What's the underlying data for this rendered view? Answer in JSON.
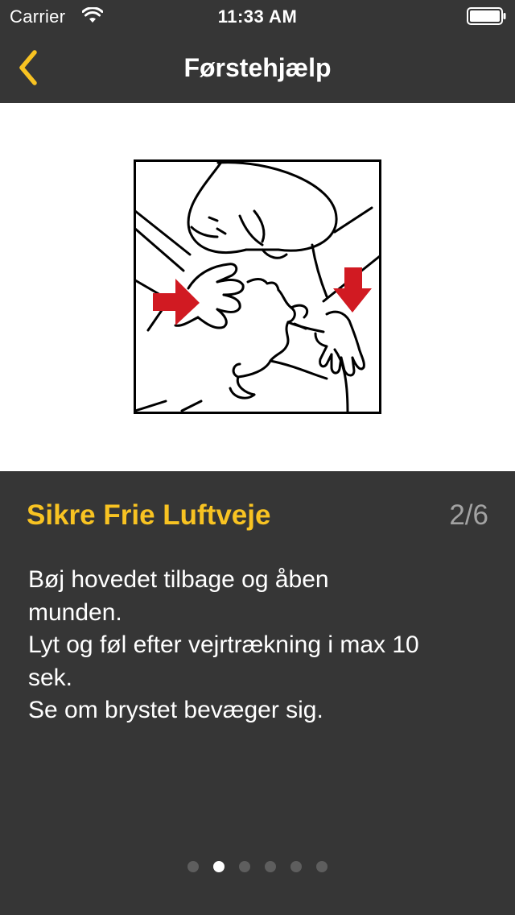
{
  "status_bar": {
    "carrier": "Carrier",
    "time": "11:33 AM",
    "icons": [
      "wifi-icon",
      "battery-icon"
    ]
  },
  "nav": {
    "title": "Førstehjælp",
    "back_icon": "chevron-left-icon",
    "accent_color": "#f8c322"
  },
  "illustration": {
    "icon": "cpr-airway-illustration",
    "arrow_color": "#d11a22"
  },
  "step": {
    "title": "Sikre Frie Luftveje",
    "counter": "2/6",
    "lines": [
      "Bøj hovedet tilbage og åben",
      "munden.",
      "Lyt og føl efter vejrtrækning i max 10",
      "sek.",
      "Se om brystet bevæger sig."
    ]
  },
  "pager": {
    "total": 6,
    "current": 2
  },
  "colors": {
    "background": "#363636",
    "title": "#f8c322",
    "counter": "#a3a3a3",
    "text": "#ffffff"
  }
}
